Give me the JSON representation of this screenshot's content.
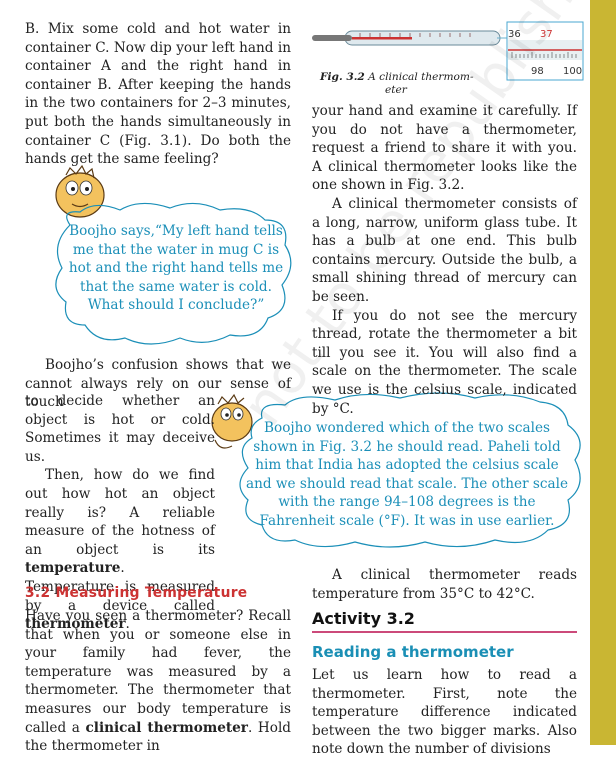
{
  "left_top_text": "B. Mix some cold and hot water in container C. Now dip your left hand in container A and the right hand in container B. After keeping the hands in the two containers for 2–3 minutes, put both the hands simultaneously in container C (Fig. 3.1). Do both the hands get the same feeling?",
  "cloud1": "Boojho says,“My left hand tells me that the water in mug C is hot and the right hand tells me that the same water is cold. What should I conclude?”",
  "figure_caption_label": "Fig. 3.2",
  "figure_caption_text": "A clinical thermom-",
  "figure_caption_text2": "eter",
  "right_p1": "your hand and examine it carefully. If you do not have a thermometer, request a friend to share it with you. A clinical thermometer looks like the one shown in Fig. 3.2.",
  "right_p2": "A clinical thermometer consists of a long, narrow, uniform glass tube. It has a bulb at one end. This bulb contains mercury. Outside the bulb, a small shining thread of mercury can be seen.",
  "right_p3": "If you do not see the mercury thread, rotate the thermometer a bit till you see it. You will also find a scale on the thermometer. The scale we use is the celsius scale, indicated by °C.",
  "left_mid_p1": "Boojho’s confusion shows that we cannot always rely on our sense of touch",
  "left_narrow_p1": "to decide whether an object is hot or cold. Sometimes it may deceive us.",
  "left_narrow_p2a": "Then, how do we find out how hot an object really is? A reliable measure of the hotness of an object is its ",
  "left_narrow_bold1": "temperature",
  "left_narrow_p2b": ". Temperature is measured by a device called ",
  "left_narrow_bold2": "thermometer",
  "left_narrow_p2c": ".",
  "cloud2": "Boojho wondered which of the two scales shown in Fig. 3.2 he should read. Paheli told him that India has adopted the celsius scale and we should read that scale. The other scale with the range 94–108 degrees is the Fahrenheit scale (°F). It was in use earlier.",
  "right_bottom_p": "A clinical thermometer reads temperature from 35°C to 42°C.",
  "section_heading": "3.2 Measuring Temperature",
  "activity_heading": "Activity 3.2",
  "reading_heading": "Reading a thermometer",
  "left_bottom_a": "Have you seen a thermometer? Recall that when you or someone else in your family had fever, the temperature was measured by a thermometer. The thermometer that measures our body temperature is called a ",
  "left_bottom_bold1": "clinical thermometer",
  "left_bottom_b": ". Hold the thermometer in",
  "reading_text": "Let us learn how to read a thermometer. First, note the temperature difference indicated between the two bigger marks. Also note down the number of divisions",
  "thermo_labels": {
    "c36": "36",
    "c37": "37",
    "f98": "98",
    "f100": "100"
  },
  "colors": {
    "accent_red": "#cc3333",
    "cloud_blue": "#1b8fb8",
    "sidebar": "#c9b633"
  }
}
